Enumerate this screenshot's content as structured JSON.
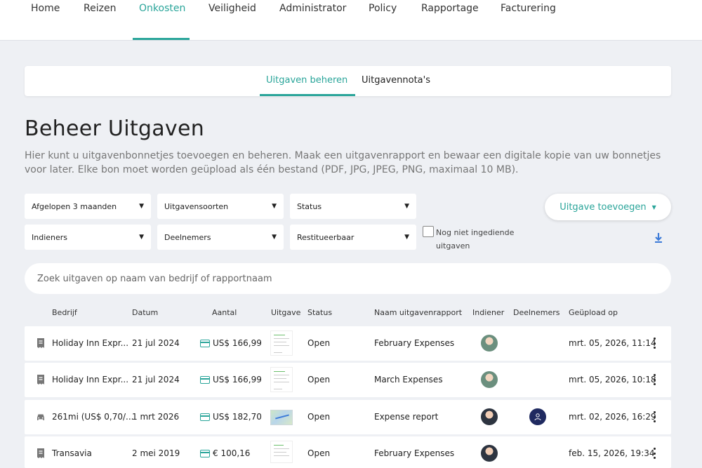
{
  "nav": {
    "items": [
      "Home",
      "Reizen",
      "Onkosten",
      "Veiligheid",
      "Administrator",
      "Policy",
      "Rapportage",
      "Facturering"
    ],
    "active": "Onkosten"
  },
  "subtabs": [
    "Uitgaven beheren",
    "Uitgavennota's"
  ],
  "page": {
    "title": "Beheer Uitgaven",
    "description": "Hier kunt u uitgavenbonnetjes toevoegen en beheren. Maak een uitgavenrapport en bewaar een digitale kopie van uw bonnetjes voor later. Elke bon moet worden geüpload als één bestand (PDF, JPG, JPEG, PNG, maximaal 10 MB)."
  },
  "filters": {
    "period": "Afgelopen 3 maanden",
    "types": "Uitgavensoorten",
    "status": "Status",
    "submitters": "Indieners",
    "participants": "Deelnemers",
    "refundable": "Restitueerbaar",
    "not_submitted_label": "Nog niet ingediende uitgaven"
  },
  "add_button": "Uitgave toevoegen",
  "search": {
    "placeholder": "Zoek uitgaven op naam van bedrijf of rapportnaam"
  },
  "table": {
    "headers": {
      "company": "Bedrijf",
      "date": "Datum",
      "amount": "Aantal",
      "expense": "Uitgave",
      "status": "Status",
      "report": "Naam uitgavenrapport",
      "submitter": "Indiener",
      "participants": "Deelnemers",
      "uploaded": "Geüpload op"
    },
    "rows": [
      {
        "icon": "receipt-icon",
        "company": "Holiday Inn Expr...",
        "date": "21 jul 2024",
        "amount": "US$ 166,99",
        "status": "Open",
        "report": "February Expenses",
        "uploaded": "mrt. 05, 2026, 11:14"
      },
      {
        "icon": "receipt-icon",
        "company": "Holiday Inn Expr...",
        "date": "21 jul 2024",
        "amount": "US$ 166,99",
        "status": "Open",
        "report": "March Expenses",
        "uploaded": "mrt. 05, 2026, 10:18"
      },
      {
        "icon": "car-icon",
        "company": "261mi (US$ 0,70/...",
        "date": "1 mrt 2026",
        "amount": "US$ 182,70",
        "status": "Open",
        "report": "Expense report",
        "uploaded": "mrt. 02, 2026, 16:29"
      },
      {
        "icon": "receipt-icon",
        "company": "Transavia",
        "date": "2 mei 2019",
        "amount": "€ 100,16",
        "status": "Open",
        "report": "February Expenses",
        "uploaded": "feb. 15, 2026, 19:34"
      }
    ]
  },
  "colors": {
    "accent": "#2aa59a",
    "background": "#eef0f4",
    "participant_badge": "#1f2a60"
  }
}
